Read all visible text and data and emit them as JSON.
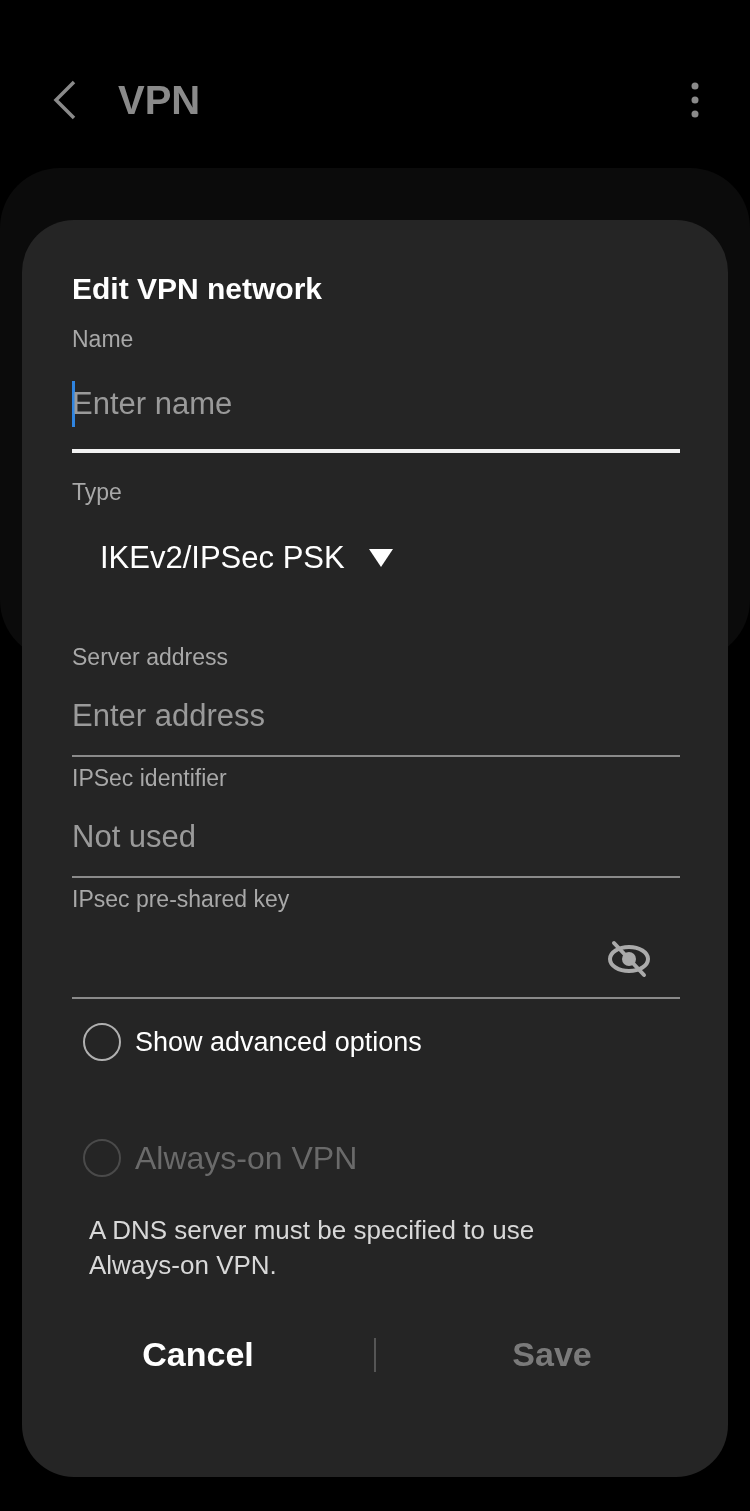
{
  "header": {
    "title": "VPN"
  },
  "dialog": {
    "title": "Edit VPN network",
    "fields": [
      {
        "kind": "text",
        "label": "Name",
        "placeholder": "Enter name",
        "focused": true
      },
      {
        "kind": "dropdown",
        "label": "Type",
        "value": "IKEv2/IPSec PSK"
      },
      {
        "kind": "text",
        "label": "Server address",
        "placeholder": "Enter address",
        "focused": false
      },
      {
        "kind": "text",
        "label": "IPSec identifier",
        "placeholder": "Not used",
        "focused": false
      },
      {
        "kind": "password",
        "label": "IPsec pre-shared key",
        "focused": false
      }
    ],
    "options": [
      {
        "label": "Show advanced options",
        "checked": false,
        "disabled": false
      },
      {
        "label": "Always-on VPN",
        "checked": false,
        "disabled": true
      }
    ],
    "note": "A DNS server must be specified to use Always-on VPN.",
    "buttons": [
      {
        "label": "Cancel",
        "disabled": false
      },
      {
        "label": "Save",
        "disabled": true
      }
    ]
  }
}
